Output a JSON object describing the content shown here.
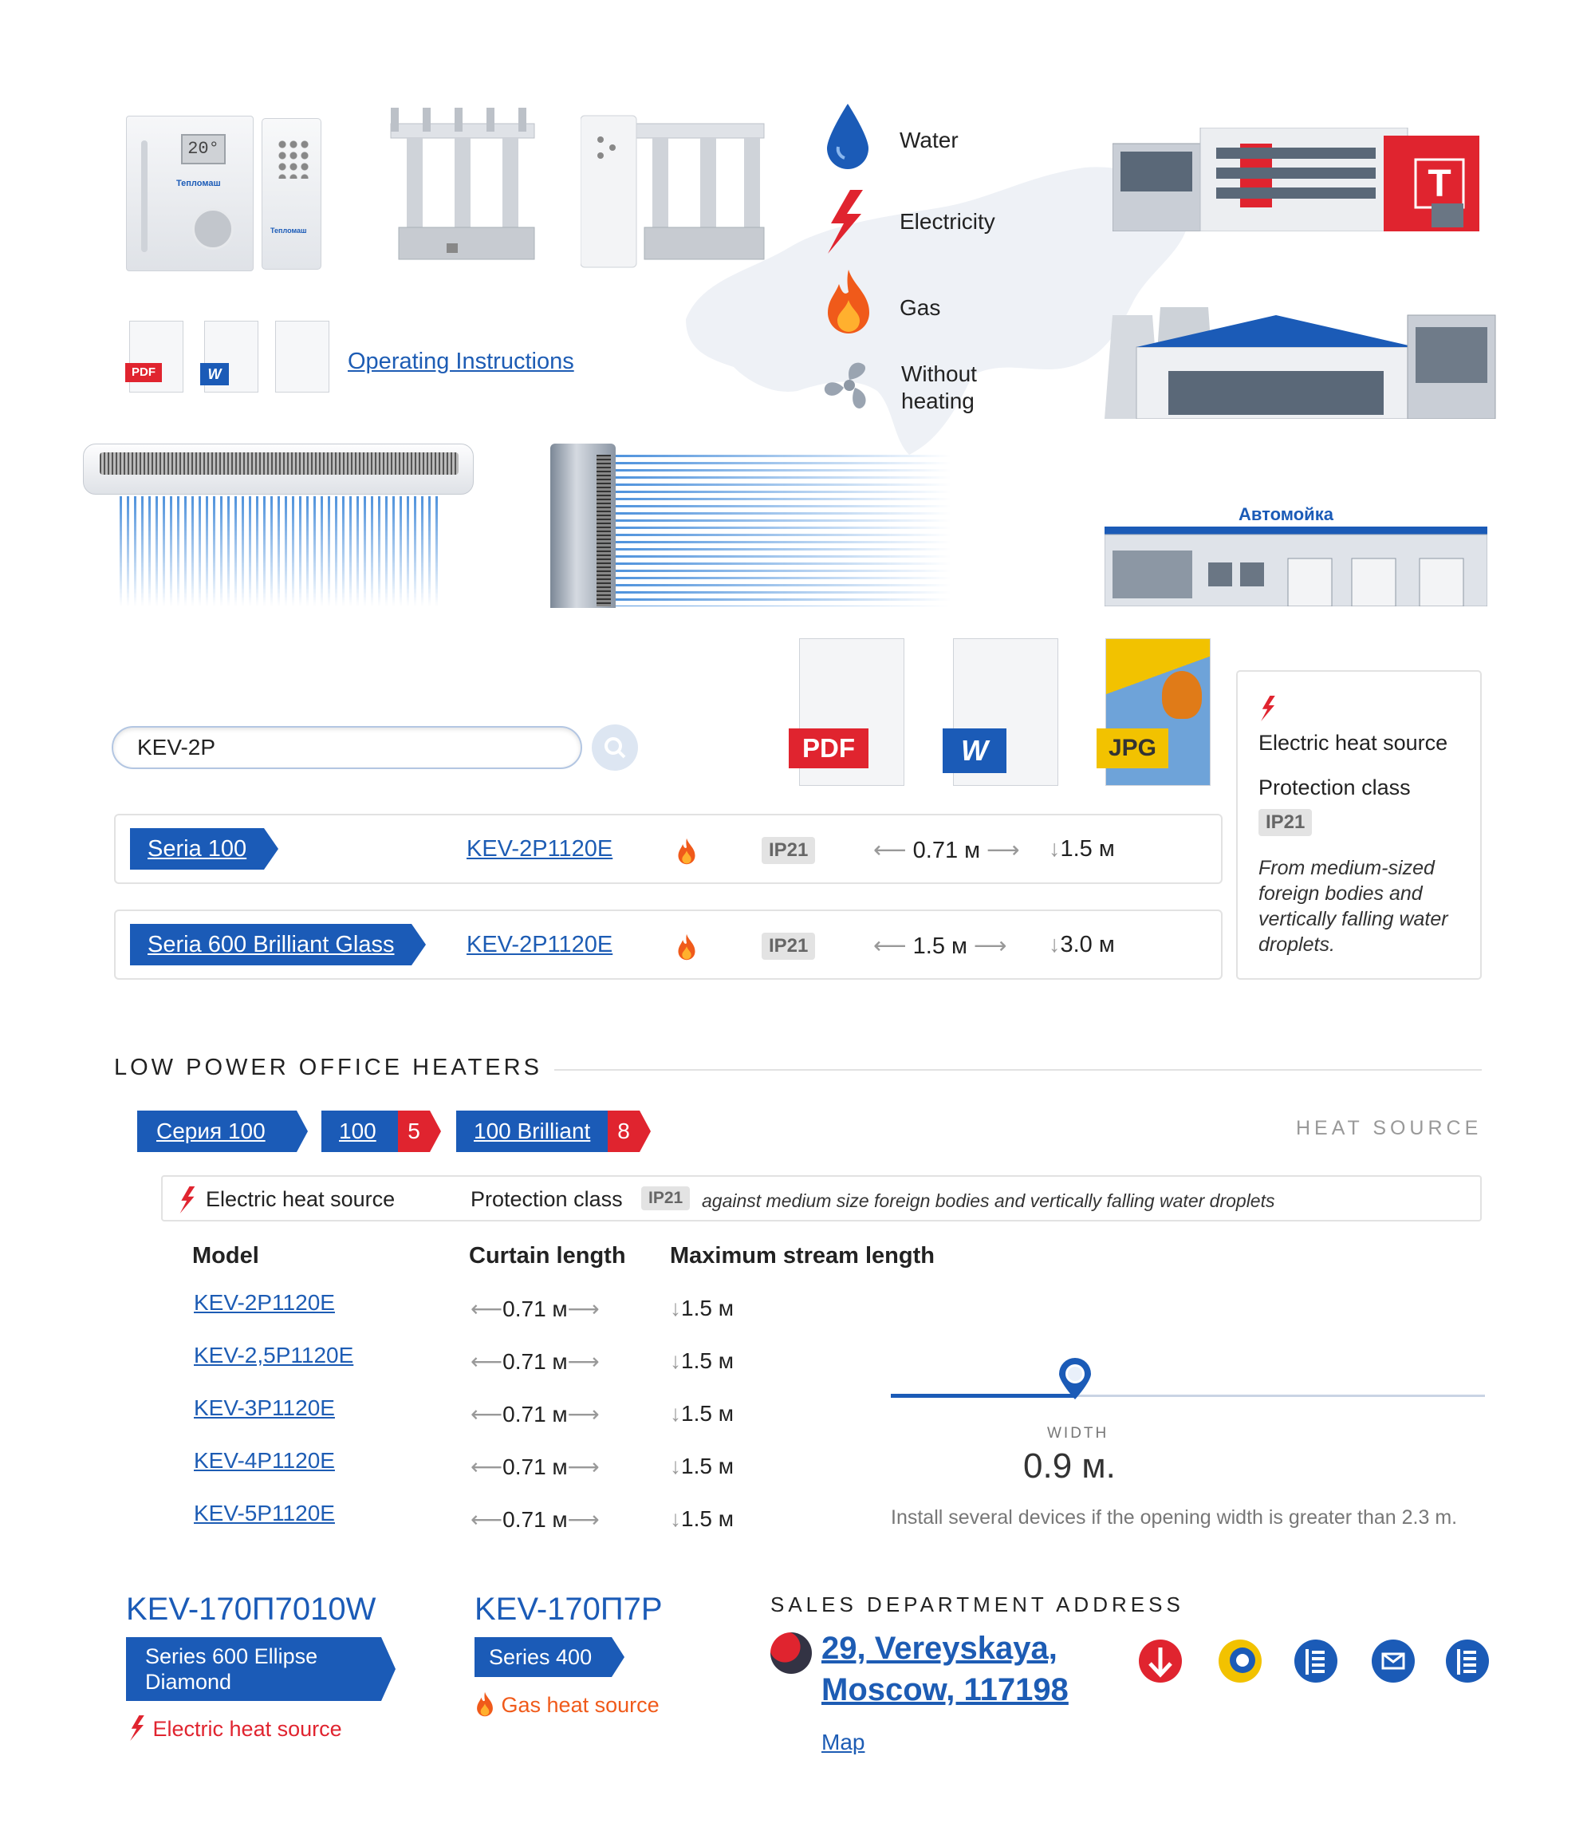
{
  "heat_sources": {
    "water": "Water",
    "electricity": "Electricity",
    "gas": "Gas",
    "without_heating": [
      "Without",
      "heating"
    ]
  },
  "docs": {
    "operating_instructions": "Operating Instructions",
    "pdf_small": "PDF",
    "pdf_large": "PDF",
    "jpg_large": "JPG"
  },
  "brand_label": "Тепломаш",
  "thermostat_display": "20°",
  "building_car_wash_label": "Автомойка",
  "search": {
    "value": "KEV-2P"
  },
  "results": [
    {
      "series": "Seria 100",
      "model": "KEV-2P1120E",
      "ip": "IP21",
      "length": "0.71 м",
      "stream": "1.5 м"
    },
    {
      "series": "Seria 600 Brilliant Glass",
      "model": "KEV-2P1120E",
      "ip": "IP21",
      "length": "1.5 м",
      "stream": "3.0 м"
    }
  ],
  "info_card": {
    "heat_source": "Electric heat source",
    "protection_label": "Protection class",
    "ip": "IP21",
    "description": [
      "From medium-sized",
      "foreign bodies and",
      "vertically falling water",
      "droplets."
    ]
  },
  "section": {
    "title": "LOW POWER OFFICE HEATERS",
    "heat_source_label": "HEAT SOURCE",
    "chips": [
      {
        "label": "Серия 100"
      },
      {
        "label": "100",
        "count": "5"
      },
      {
        "label": "100 Brilliant",
        "count": "8"
      }
    ],
    "info_bar": {
      "heat_source": "Electric heat source",
      "protection_label": "Protection class",
      "ip": "IP21",
      "note": "against medium size foreign bodies and vertically falling water droplets"
    },
    "table": {
      "headers": [
        "Model",
        "Curtain length",
        "Maximum stream length"
      ],
      "rows": [
        {
          "model": "KEV-2P1120E",
          "length": "0.71 м",
          "stream": "1.5 м"
        },
        {
          "model": "KEV-2,5P1120E",
          "length": "0.71 м",
          "stream": "1.5 м"
        },
        {
          "model": "KEV-3P1120E",
          "length": "0.71 м",
          "stream": "1.5 м"
        },
        {
          "model": "KEV-4P1120E",
          "length": "0.71 м",
          "stream": "1.5 м"
        },
        {
          "model": "KEV-5P1120E",
          "length": "0.71 м",
          "stream": "1.5 м"
        }
      ]
    },
    "slider": {
      "label": "WIDTH",
      "value": "0.9 м.",
      "fraction": 0.31,
      "note": "Install several devices if the opening width is greater than 2.3 m."
    }
  },
  "products": [
    {
      "model": "KEV-170П7010W",
      "series": [
        "Series 600 Ellipse",
        "Diamond"
      ],
      "heat": "Electric heat source"
    },
    {
      "model": "KEV-170П7P",
      "series": [
        "Series 400"
      ],
      "heat": "Gas heat source"
    }
  ],
  "address": {
    "title": "SALES DEPARTMENT ADDRESS",
    "line1": "29, Vereyskaya,",
    "line2": "Moscow, 117198",
    "map_link": "Map"
  },
  "colors": {
    "accent": "#1b5bb7",
    "red": "#e0242f",
    "gas_orange": "#f05a1a",
    "link": "#1d5cb4"
  }
}
